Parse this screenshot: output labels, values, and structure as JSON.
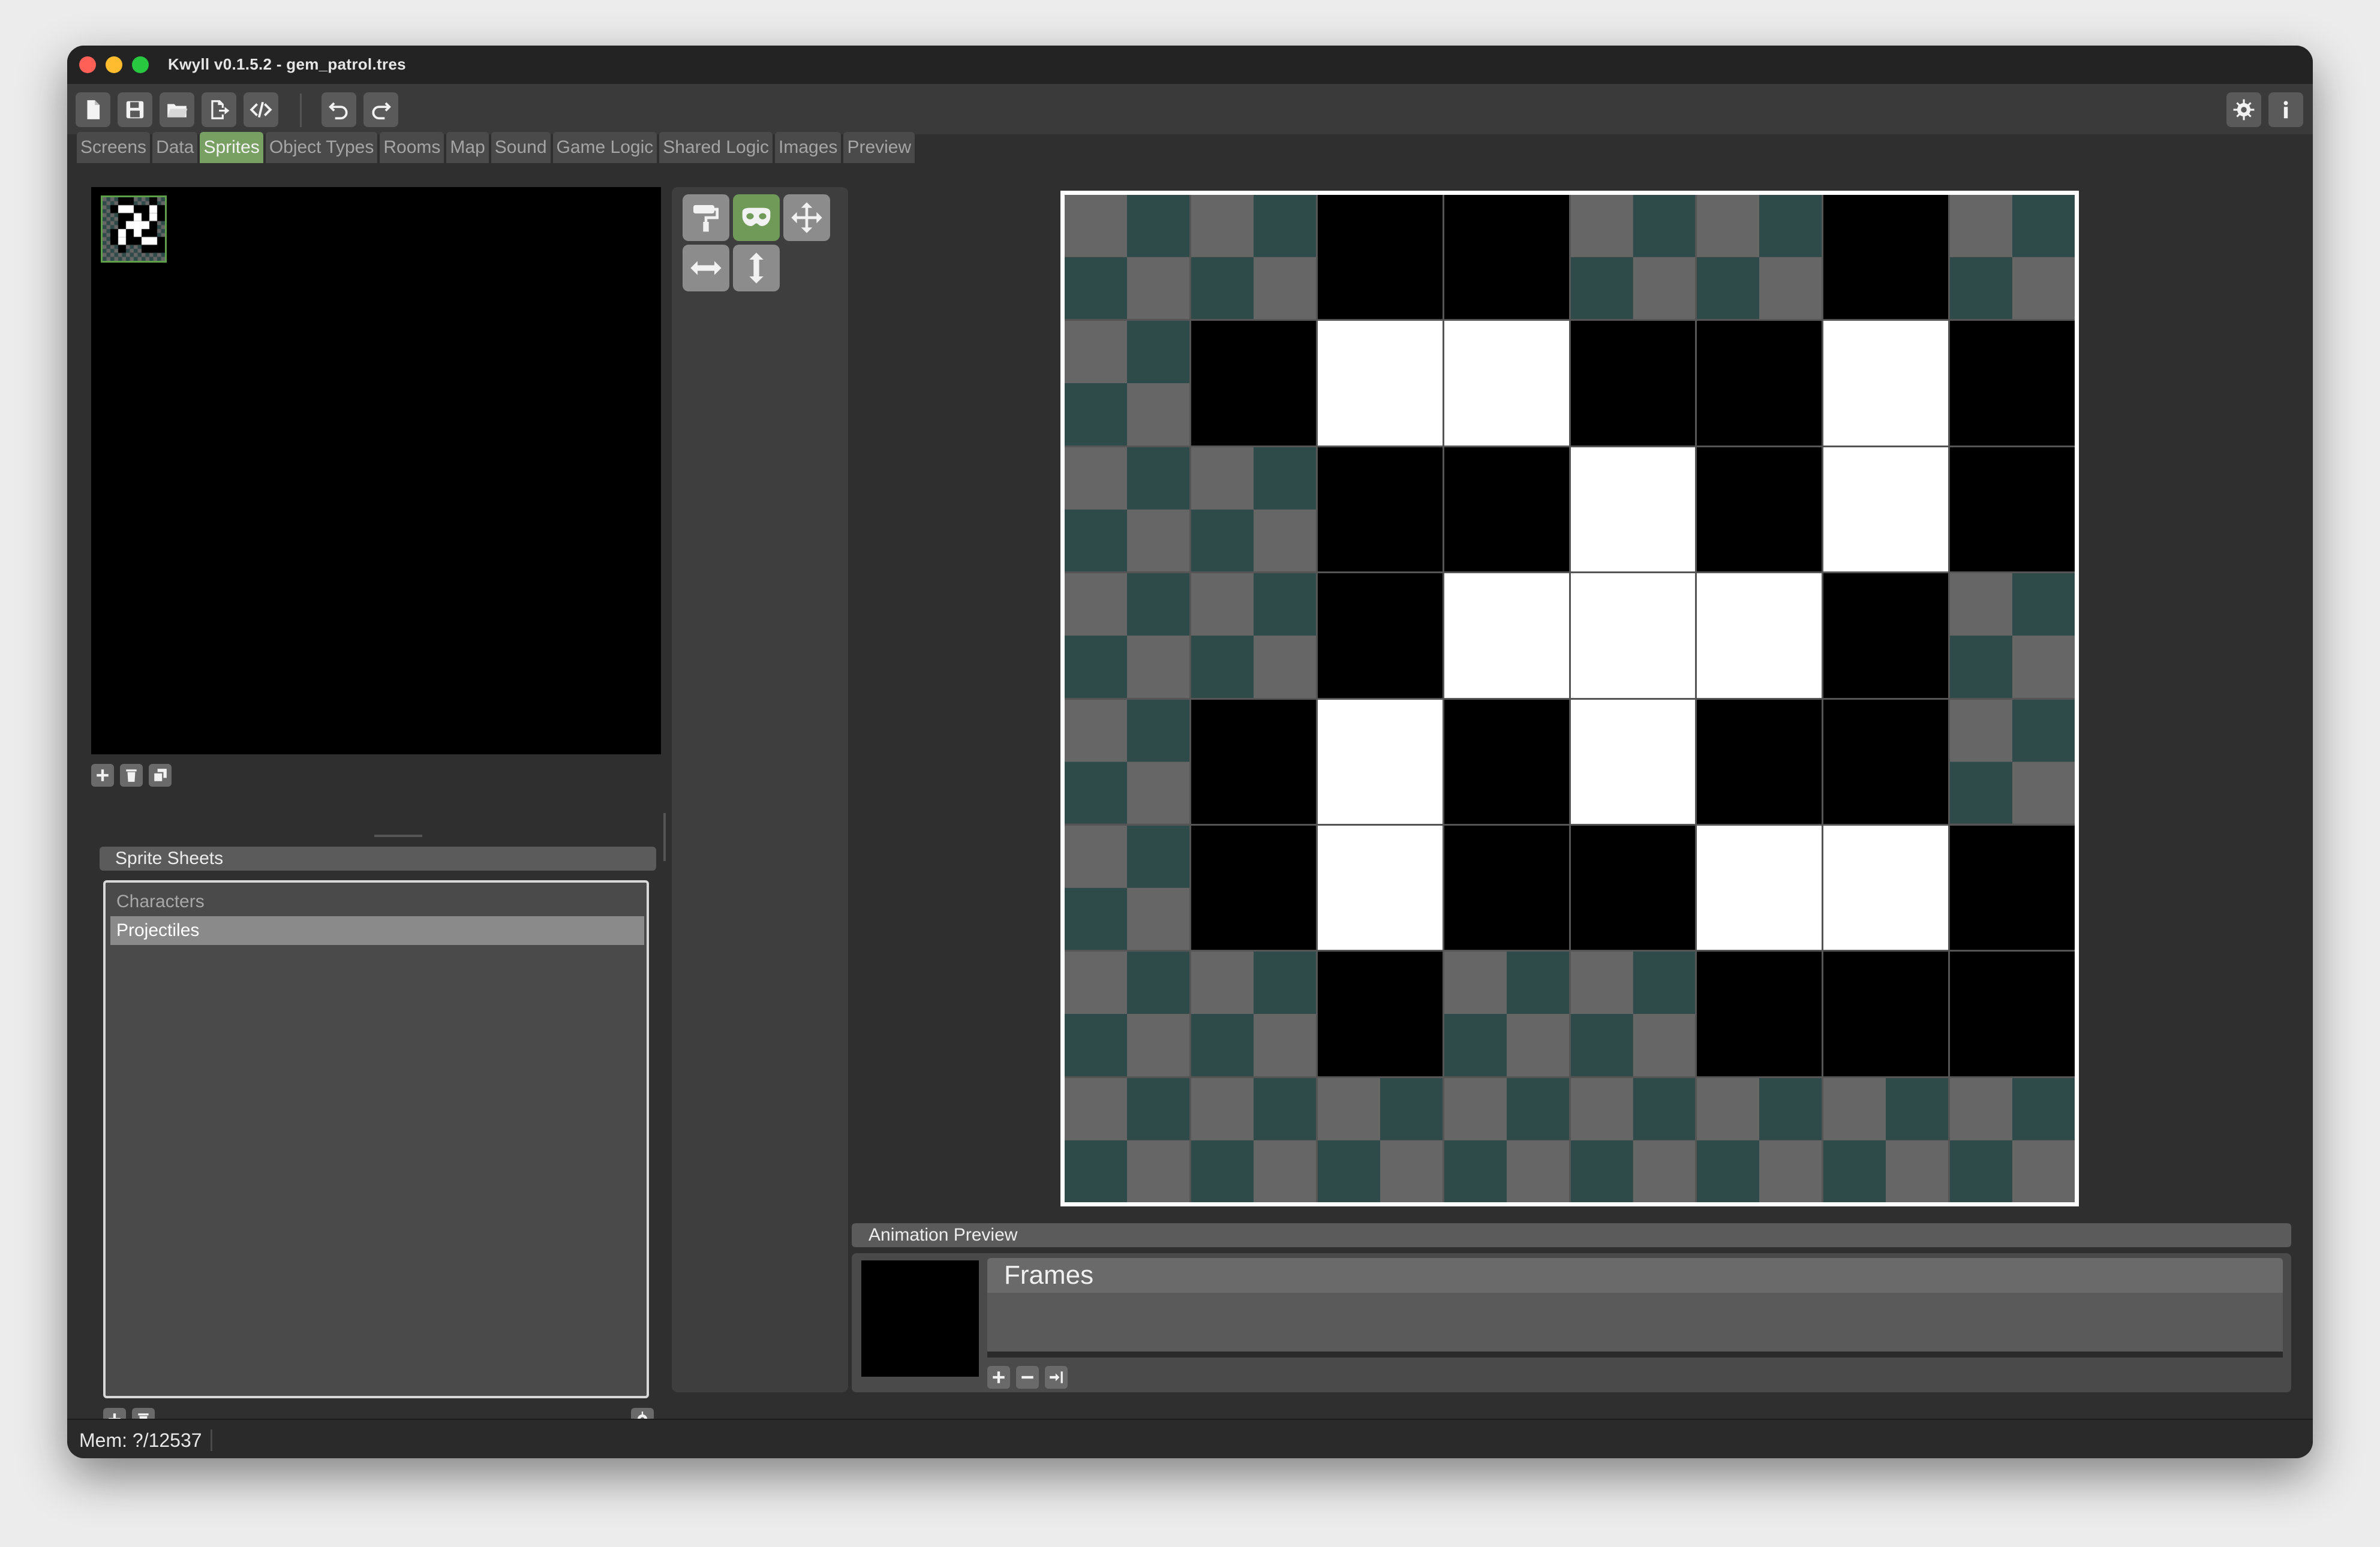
{
  "window": {
    "title": "Kwyll v0.1.5.2 - gem_patrol.tres"
  },
  "toolbar": {
    "icons": [
      "new-file-icon",
      "save-icon",
      "open-folder-icon",
      "export-icon",
      "code-icon",
      "undo-icon",
      "redo-icon",
      "gear-icon",
      "info-icon"
    ]
  },
  "tabs": [
    {
      "label": "Screens"
    },
    {
      "label": "Data"
    },
    {
      "label": "Sprites",
      "active": true
    },
    {
      "label": "Object Types"
    },
    {
      "label": "Rooms"
    },
    {
      "label": "Map"
    },
    {
      "label": "Sound"
    },
    {
      "label": "Game Logic"
    },
    {
      "label": "Shared Logic"
    },
    {
      "label": "Images"
    },
    {
      "label": "Preview"
    }
  ],
  "sprite_sheets": {
    "header": "Sprite Sheets",
    "items": [
      {
        "label": "Characters",
        "selected": false
      },
      {
        "label": "Projectiles",
        "selected": true
      }
    ]
  },
  "tools": {
    "items": [
      "paint-roller-icon",
      "mask-icon",
      "move-icon",
      "flip-horizontal-icon",
      "flip-vertical-icon"
    ],
    "active": "mask-icon"
  },
  "pixel_grid": {
    "size": 8,
    "legend": {
      "T": "transparent",
      "B": "black",
      "W": "white"
    },
    "rows": [
      "TTBBTTBT",
      "TBWWBBWB",
      "TTBBWBWB",
      "TTBWWWBT",
      "TBWBWBBT",
      "TBWBBWWB",
      "TTBTTBBB",
      "TTTTTTTT"
    ]
  },
  "animation": {
    "header": "Animation Preview",
    "frames_label": "Frames"
  },
  "status": {
    "mem": "Mem: ?/12537"
  },
  "colors": {
    "accent": "#77a062",
    "checker_dark": "#2e4a49",
    "checker_light": "#666666"
  }
}
